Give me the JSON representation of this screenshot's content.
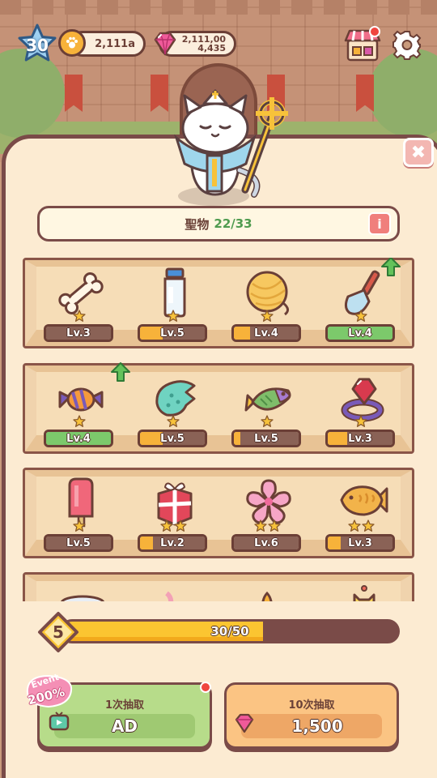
{
  "hud": {
    "player_level": "30",
    "coins": "2,111a",
    "gems_line1": "2,111,00",
    "gems_line2": "4,435"
  },
  "panel": {
    "title_label": "聖物",
    "title_count": "22/33",
    "info_label": "i",
    "close_label": "✖"
  },
  "items": [
    {
      "name": "bone",
      "level": "Lv.3",
      "stars": 1,
      "bar_color": "#8a6256",
      "fill": 0.0,
      "upgrade": false
    },
    {
      "name": "milk-bottle",
      "level": "Lv.5",
      "stars": 1,
      "bar_color": "#f7b23a",
      "fill": 0.35,
      "upgrade": false
    },
    {
      "name": "yarn-ball",
      "level": "Lv.4",
      "stars": 1,
      "bar_color": "#f7b23a",
      "fill": 0.25,
      "upgrade": false
    },
    {
      "name": "shovel",
      "level": "Lv.4",
      "stars": 1,
      "bar_color": "#7cc96b",
      "fill": 1.0,
      "upgrade": true
    },
    {
      "name": "candy",
      "level": "Lv.4",
      "stars": 1,
      "bar_color": "#7cc96b",
      "fill": 1.0,
      "upgrade": true
    },
    {
      "name": "seashell",
      "level": "Lv.5",
      "stars": 1,
      "bar_color": "#f7b23a",
      "fill": 0.35,
      "upgrade": false
    },
    {
      "name": "fish",
      "level": "Lv.5",
      "stars": 1,
      "bar_color": "#f7b23a",
      "fill": 0.1,
      "upgrade": false
    },
    {
      "name": "ruby-ring",
      "level": "Lv.3",
      "stars": 1,
      "bar_color": "#f7b23a",
      "fill": 0.3,
      "upgrade": false
    },
    {
      "name": "popsicle",
      "level": "Lv.5",
      "stars": 1,
      "bar_color": "#8a6256",
      "fill": 0.0,
      "upgrade": false
    },
    {
      "name": "gift-box",
      "level": "Lv.2",
      "stars": 2,
      "bar_color": "#f7b23a",
      "fill": 0.2,
      "upgrade": false
    },
    {
      "name": "sakura-flower",
      "level": "Lv.6",
      "stars": 2,
      "bar_color": "#8a6256",
      "fill": 0.0,
      "upgrade": false
    },
    {
      "name": "taiyaki",
      "level": "Lv.3",
      "stars": 2,
      "bar_color": "#f7b23a",
      "fill": 0.2,
      "upgrade": false
    }
  ],
  "progress": {
    "level": "5",
    "text": "30/50",
    "fraction": 0.6
  },
  "buttons": {
    "draw_one_caption": "1次抽取",
    "draw_one_label": "AD",
    "draw_ten_caption": "10次抽取",
    "draw_ten_price": "1,500",
    "event_word": "Event",
    "event_percent": "200%"
  },
  "colors": {
    "panel_bg": "#fcebd2",
    "panel_border": "#7a4b48",
    "accent_green": "#4f9b4f",
    "progress_fill": "#fbc531"
  }
}
